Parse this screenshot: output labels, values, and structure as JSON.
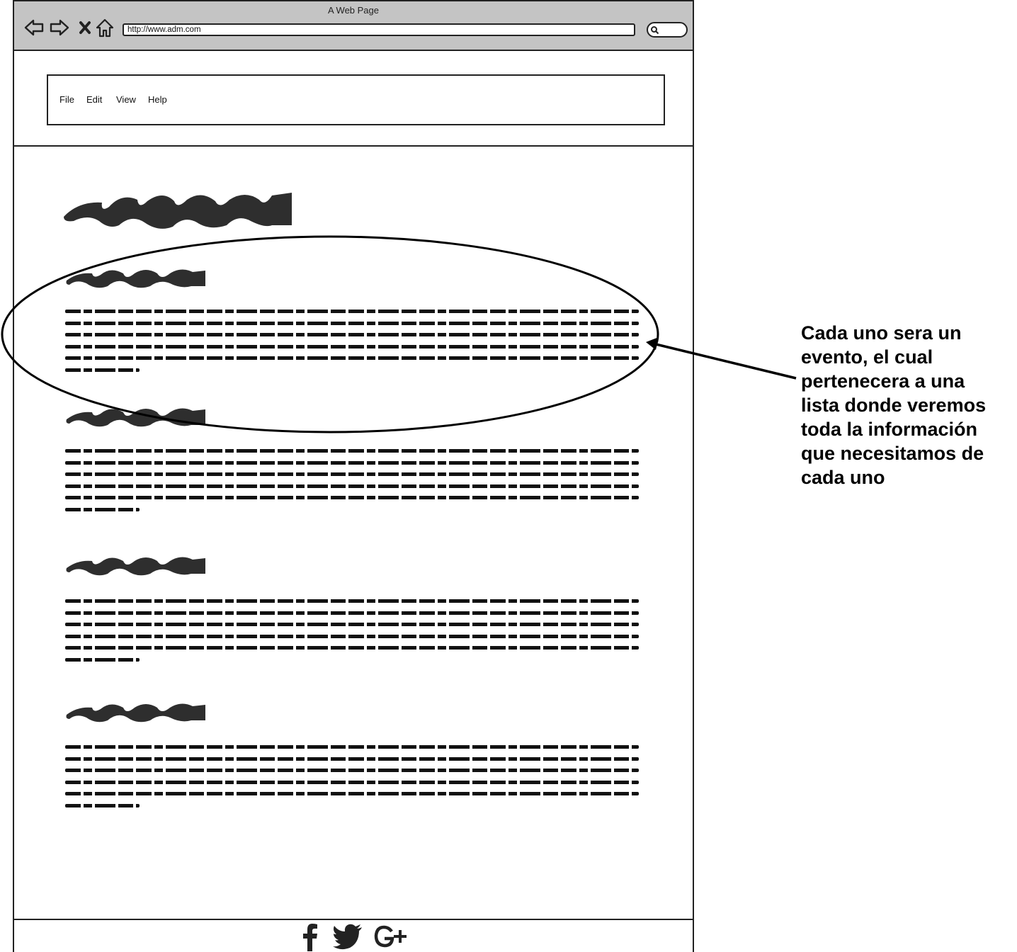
{
  "window": {
    "title": "A Web Page",
    "url": "http://www.adm.com"
  },
  "menu": {
    "items": [
      "File",
      "Edit",
      "View",
      "Help"
    ]
  },
  "annotation": {
    "text": "Cada uno sera un\nevento, el cual\npertenecera a una\nlista donde veremos\ntoda la información\nque necesitamos de\ncada uno"
  },
  "footer": {
    "icons": [
      "facebook-icon",
      "twitter-icon",
      "google-plus-icon"
    ]
  }
}
